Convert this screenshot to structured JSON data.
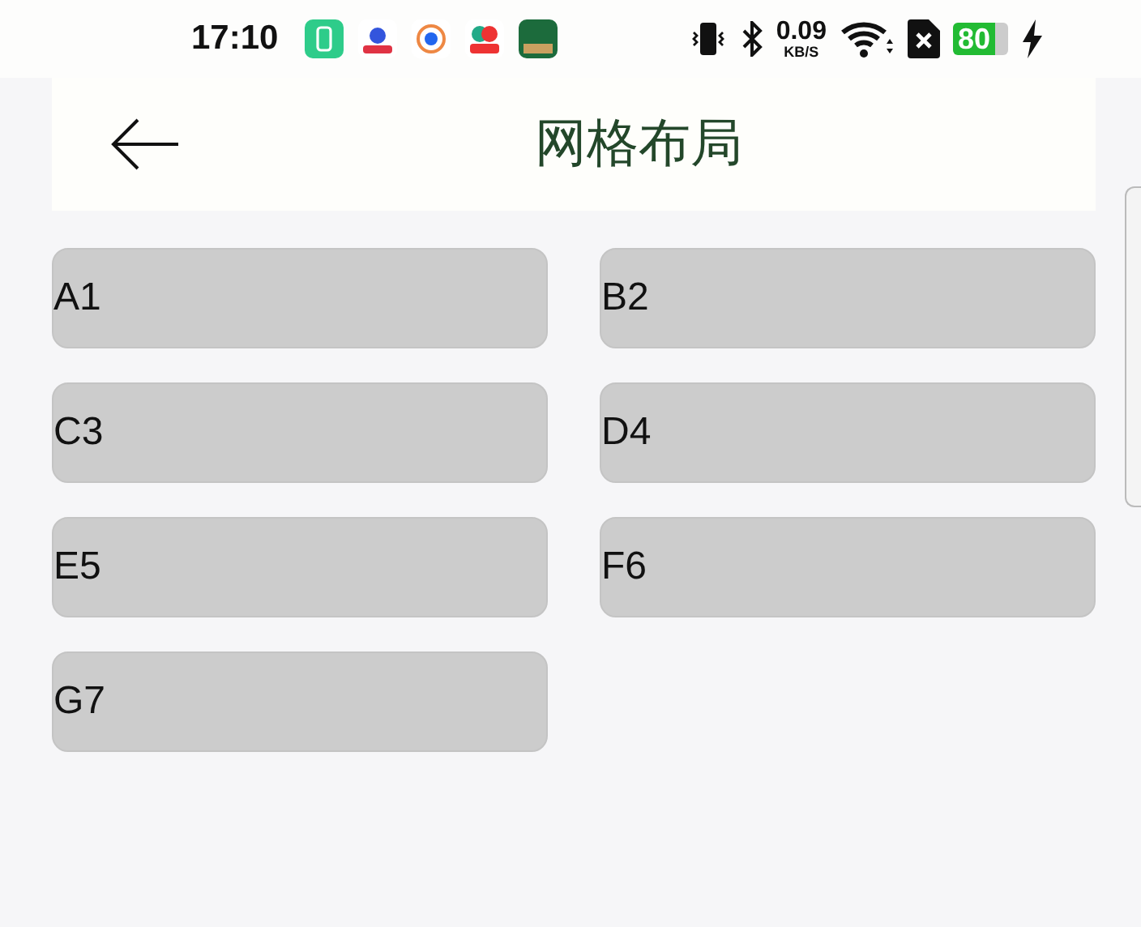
{
  "status_bar": {
    "time": "17:10",
    "network_speed": "0.09",
    "network_unit": "KB/S",
    "battery": "80",
    "charging": true
  },
  "header": {
    "title": "网格布局"
  },
  "grid": {
    "items": [
      {
        "label": "A1"
      },
      {
        "label": "B2"
      },
      {
        "label": "C3"
      },
      {
        "label": "D4"
      },
      {
        "label": "E5"
      },
      {
        "label": "F6"
      },
      {
        "label": "G7"
      }
    ]
  }
}
